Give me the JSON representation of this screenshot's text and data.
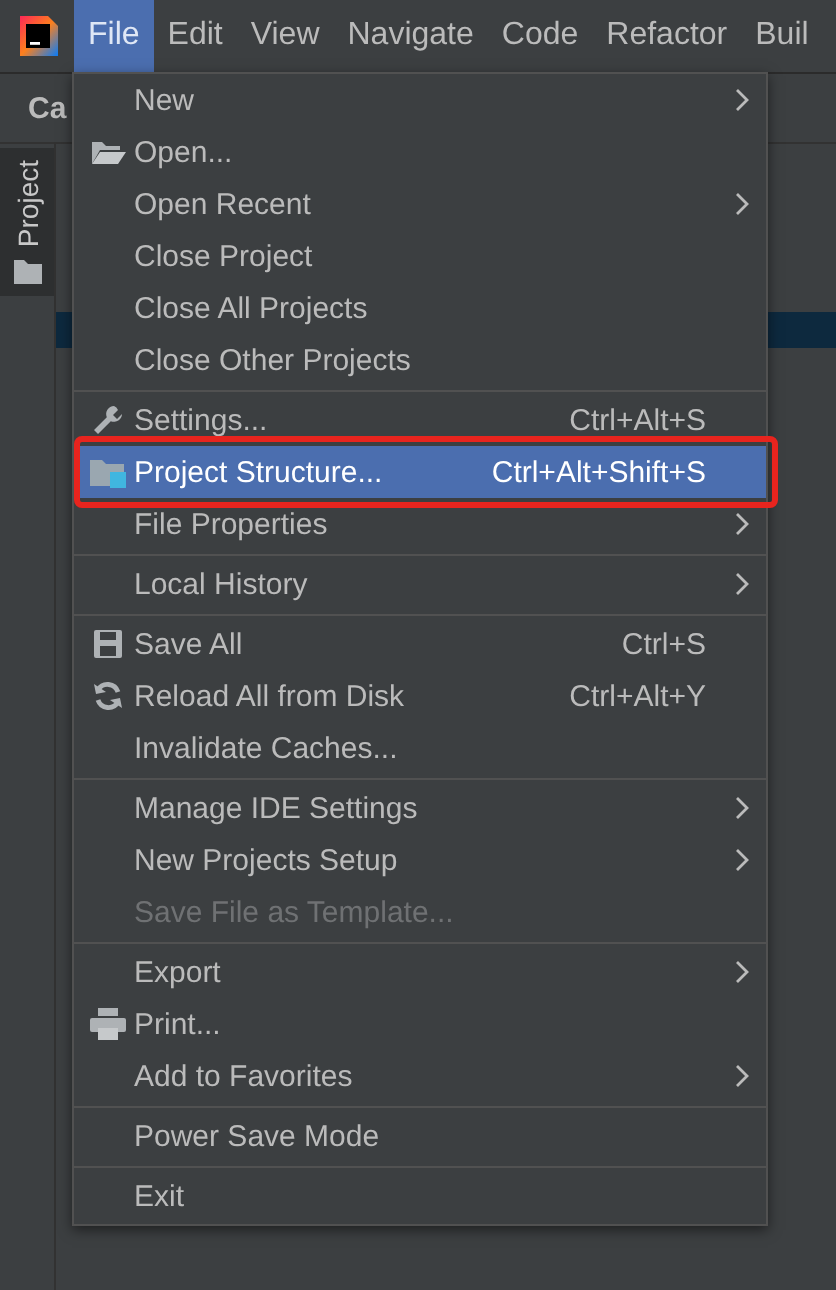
{
  "menubar": {
    "items": [
      {
        "label": "File",
        "selected": true
      },
      {
        "label": "Edit",
        "selected": false
      },
      {
        "label": "View",
        "selected": false
      },
      {
        "label": "Navigate",
        "selected": false
      },
      {
        "label": "Code",
        "selected": false
      },
      {
        "label": "Refactor",
        "selected": false
      },
      {
        "label": "Buil",
        "selected": false
      }
    ]
  },
  "tool_strip": {
    "tab": "Project"
  },
  "panel_title": "Ca",
  "menu": {
    "items": [
      {
        "kind": "item",
        "label": "New",
        "submenu": true,
        "disabled": false,
        "selected": false
      },
      {
        "kind": "item",
        "label": "Open...",
        "submenu": false,
        "disabled": false,
        "selected": false
      },
      {
        "kind": "item",
        "label": "Open Recent",
        "submenu": true,
        "disabled": false,
        "selected": false
      },
      {
        "kind": "item",
        "label": "Close Project",
        "submenu": false,
        "disabled": false,
        "selected": false
      },
      {
        "kind": "item",
        "label": "Close All Projects",
        "submenu": false,
        "disabled": false,
        "selected": false
      },
      {
        "kind": "item",
        "label": "Close Other Projects",
        "submenu": false,
        "disabled": false,
        "selected": false
      },
      {
        "kind": "separator"
      },
      {
        "kind": "item",
        "label": "Settings...",
        "shortcut": "Ctrl+Alt+S",
        "submenu": false,
        "disabled": false,
        "selected": false
      },
      {
        "kind": "item",
        "label": "Project Structure...",
        "shortcut": "Ctrl+Alt+Shift+S",
        "submenu": false,
        "disabled": false,
        "selected": true,
        "annotated": true
      },
      {
        "kind": "item",
        "label": "File Properties",
        "submenu": true,
        "disabled": false,
        "selected": false
      },
      {
        "kind": "separator"
      },
      {
        "kind": "item",
        "label": "Local History",
        "submenu": true,
        "disabled": false,
        "selected": false
      },
      {
        "kind": "separator"
      },
      {
        "kind": "item",
        "label": "Save All",
        "shortcut": "Ctrl+S",
        "submenu": false,
        "disabled": false,
        "selected": false
      },
      {
        "kind": "item",
        "label": "Reload All from Disk",
        "shortcut": "Ctrl+Alt+Y",
        "submenu": false,
        "disabled": false,
        "selected": false
      },
      {
        "kind": "item",
        "label": "Invalidate Caches...",
        "submenu": false,
        "disabled": false,
        "selected": false
      },
      {
        "kind": "separator"
      },
      {
        "kind": "item",
        "label": "Manage IDE Settings",
        "submenu": true,
        "disabled": false,
        "selected": false
      },
      {
        "kind": "item",
        "label": "New Projects Setup",
        "submenu": true,
        "disabled": false,
        "selected": false
      },
      {
        "kind": "item",
        "label": "Save File as Template...",
        "submenu": false,
        "disabled": true,
        "selected": false
      },
      {
        "kind": "separator"
      },
      {
        "kind": "item",
        "label": "Export",
        "submenu": true,
        "disabled": false,
        "selected": false
      },
      {
        "kind": "item",
        "label": "Print...",
        "submenu": false,
        "disabled": false,
        "selected": false
      },
      {
        "kind": "item",
        "label": "Add to Favorites",
        "submenu": true,
        "disabled": false,
        "selected": false
      },
      {
        "kind": "separator"
      },
      {
        "kind": "item",
        "label": "Power Save Mode",
        "submenu": false,
        "disabled": false,
        "selected": false
      },
      {
        "kind": "separator"
      },
      {
        "kind": "item",
        "label": "Exit",
        "submenu": false,
        "disabled": false,
        "selected": false
      }
    ]
  }
}
